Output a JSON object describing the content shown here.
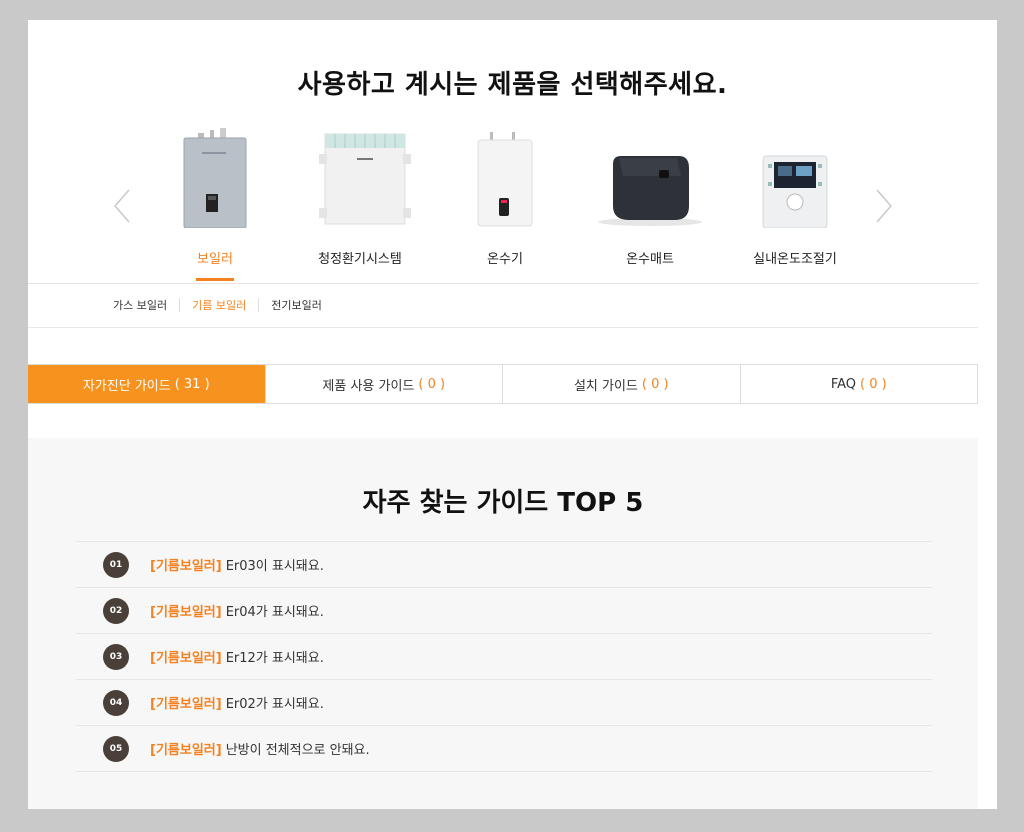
{
  "page_title": "사용하고 계시는 제품을 선택해주세요.",
  "products": [
    {
      "label": "보일러",
      "active": true
    },
    {
      "label": "청정환기시스템",
      "active": false
    },
    {
      "label": "온수기",
      "active": false
    },
    {
      "label": "온수매트",
      "active": false
    },
    {
      "label": "실내온도조절기",
      "active": false
    }
  ],
  "subcategories": [
    {
      "label": "가스 보일러",
      "active": false
    },
    {
      "label": "기름 보일러",
      "active": true
    },
    {
      "label": "전기보일러",
      "active": false
    }
  ],
  "tabs": [
    {
      "label": "자가진단 가이드",
      "count": "( 31 )",
      "active": true
    },
    {
      "label": "제품 사용 가이드",
      "count": "( 0 )",
      "active": false
    },
    {
      "label": "설치 가이드",
      "count": "( 0 )",
      "active": false
    },
    {
      "label": "FAQ",
      "count": "( 0 )",
      "active": false
    }
  ],
  "guides": {
    "title": "자주 찾는 가이드 TOP 5",
    "items": [
      {
        "num": "01",
        "category": "[기름보일러]",
        "text": "Er03이 표시돼요."
      },
      {
        "num": "02",
        "category": "[기름보일러]",
        "text": "Er04가 표시돼요."
      },
      {
        "num": "03",
        "category": "[기름보일러]",
        "text": "Er12가 표시돼요."
      },
      {
        "num": "04",
        "category": "[기름보일러]",
        "text": "Er02가 표시돼요."
      },
      {
        "num": "05",
        "category": "[기름보일러]",
        "text": "난방이 전체적으로 안돼요."
      }
    ]
  },
  "colors": {
    "accent": "#f58220",
    "tab_active": "#f7921e",
    "badge": "#4a4039"
  }
}
